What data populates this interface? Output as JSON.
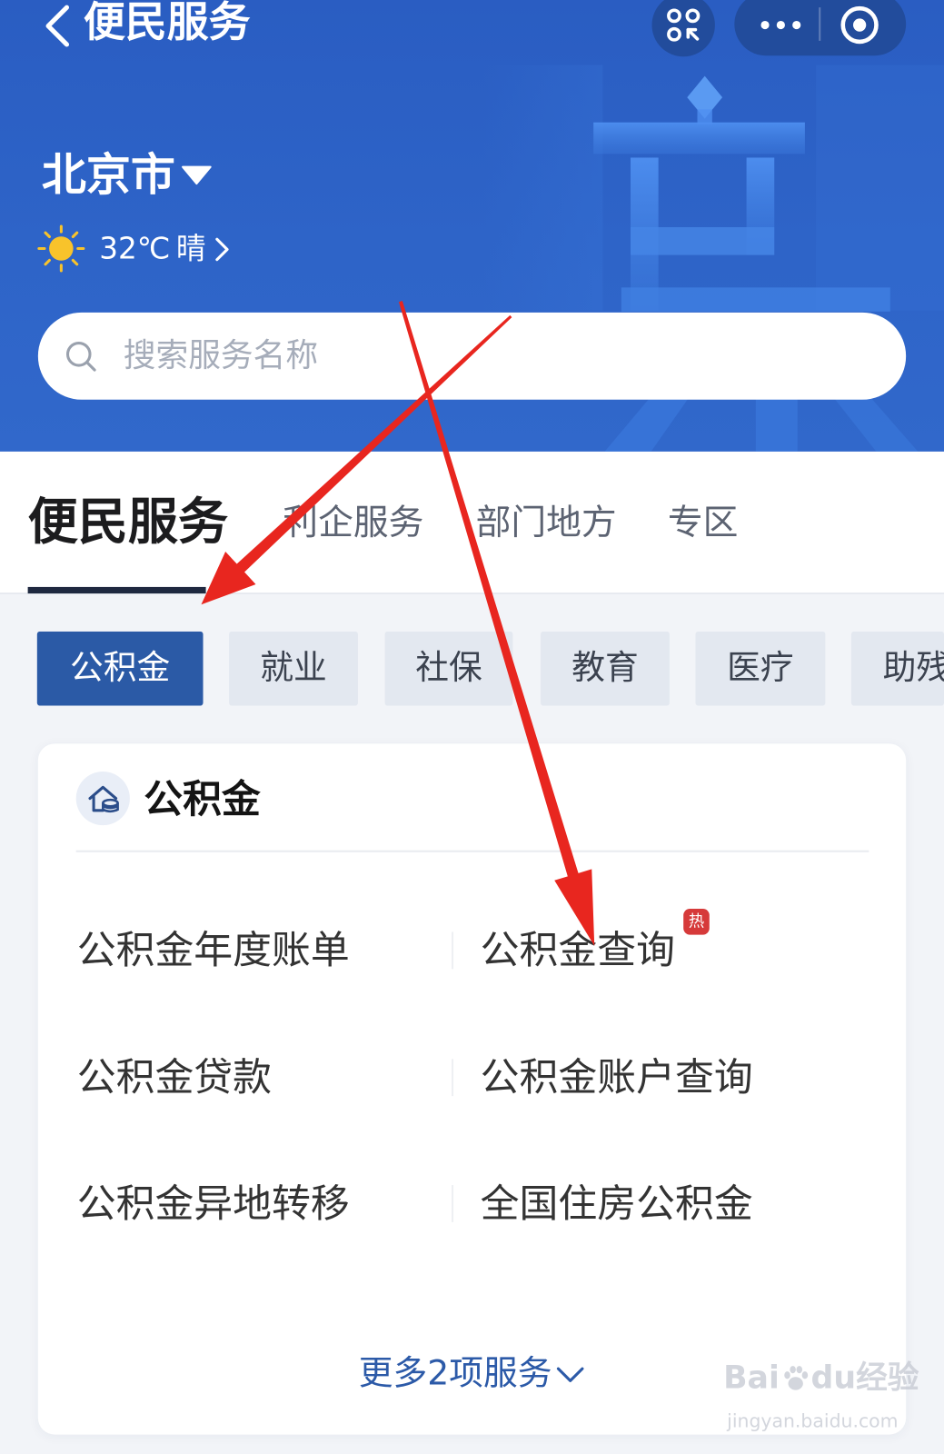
{
  "header": {
    "back_icon": "back-chevron-icon",
    "title": "便民服务",
    "apps_icon": "apps-grid-icon",
    "more_icon": "more-dots-icon",
    "close_icon": "target-circle-icon",
    "city": "北京市",
    "city_dropdown_icon": "caret-down-icon",
    "weather": {
      "icon": "sun-icon",
      "temperature": "32℃",
      "condition": "晴",
      "detail_icon": "chevron-right-icon"
    },
    "search": {
      "icon": "search-icon",
      "placeholder": "搜索服务名称"
    }
  },
  "tabs": [
    {
      "label": "便民服务",
      "active": true
    },
    {
      "label": "利企服务",
      "active": false
    },
    {
      "label": "部门地方",
      "active": false
    },
    {
      "label": "专区",
      "active": false
    }
  ],
  "categories": [
    {
      "label": "公积金",
      "selected": true
    },
    {
      "label": "就业",
      "selected": false
    },
    {
      "label": "社保",
      "selected": false
    },
    {
      "label": "教育",
      "selected": false
    },
    {
      "label": "医疗",
      "selected": false
    },
    {
      "label": "助残",
      "selected": false
    }
  ],
  "card": {
    "icon": "housing-fund-icon",
    "title": "公积金",
    "items": [
      {
        "label": "公积金年度账单"
      },
      {
        "label": "公积金查询",
        "badge": "热"
      },
      {
        "label": "公积金贷款"
      },
      {
        "label": "公积金账户查询"
      },
      {
        "label": "公积金异地转移"
      },
      {
        "label": "全国住房公积金"
      }
    ],
    "more_label": "更多2项服务",
    "more_icon": "chevron-down-icon"
  },
  "watermark": {
    "brand_left": "Bai",
    "brand_icon": "paw-icon",
    "brand_right": "du",
    "brand_suffix": "经验",
    "url": "jingyan.baidu.com"
  },
  "colors": {
    "header_bg": "#2e64c8",
    "accent": "#2b5aa6",
    "chip_bg": "#e3e8f0",
    "hot_badge": "#d63a3a",
    "sun": "#f8c32b",
    "page_bg": "#f2f4f8",
    "annotation_arrow": "#e8261f"
  }
}
